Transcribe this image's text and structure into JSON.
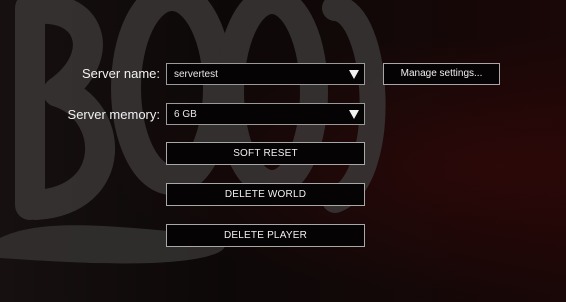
{
  "server": {
    "name_label": "Server name:",
    "name_value": "servertest",
    "memory_label": "Server memory:",
    "memory_value": "6 GB",
    "manage_settings_label": "Manage settings..."
  },
  "actions": {
    "soft_reset_label": "SOFT RESET",
    "delete_world_label": "DELETE WORLD",
    "delete_player_label": "DELETE PLAYER"
  },
  "icons": {
    "dropdown_arrow": "triangle-down-icon",
    "background_logo": "logo-backdrop"
  },
  "colors": {
    "background": "#0c0707",
    "border": "#9a9a9a",
    "text": "#f0f0f0"
  }
}
